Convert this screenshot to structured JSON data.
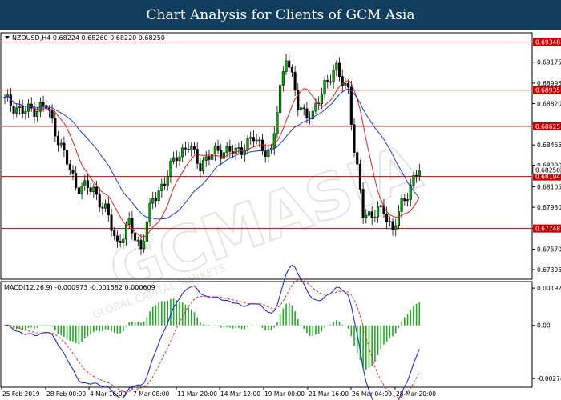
{
  "header": {
    "title": "Chart Analysis for Clients of GCM Asia"
  },
  "chart_data": {
    "type": "candlestick",
    "symbol_info": "NZDUSD,H4  0.68224 0.68260 0.68220 0.68250",
    "y_ticks": [
      "0.69175",
      "0.68995",
      "0.68820",
      "0.68645",
      "0.68465",
      "0.68290",
      "0.68105",
      "0.67930",
      "0.67750",
      "0.67570",
      "0.67395"
    ],
    "ylim": [
      0.6732,
      0.6942
    ],
    "x_ticks": [
      "25 Feb 2019",
      "28 Feb 00:00",
      "4 Mar 16:00",
      "7 Mar 08:00",
      "11 Mar 20:00",
      "14 Mar 12:00",
      "19 Mar 00:00",
      "21 Mar 16:00",
      "26 Mar 04:00",
      "28 Mar 20:00"
    ],
    "levels": [
      {
        "label": "0.69348",
        "value": 0.69348
      },
      {
        "label": "0.68935",
        "value": 0.68935
      },
      {
        "label": "0.68625",
        "value": 0.68625
      },
      {
        "label": "0.68194",
        "value": 0.68194
      },
      {
        "label": "0.67748",
        "value": 0.67748
      }
    ],
    "current_price": {
      "label": "0.68250",
      "value": 0.6825
    },
    "candle_colors": {
      "up": "#000000",
      "down": "#000000",
      "up_fill": "#00aa00",
      "down_fill": "#000000"
    },
    "ma_fast_color": "#dd2222",
    "ma_slow_color": "#1e3cd8",
    "level_color": "#cc0000",
    "macd": {
      "label": "MACD(12,26,9) -0.000973 -0.001582 0.000609",
      "y_ticks": [
        "0.001925",
        "0.00",
        "-0.002743"
      ],
      "ylim": [
        -0.00315,
        0.00222
      ],
      "line_color": "#1e2ce0",
      "signal_color": "#e03030",
      "hist_color": "#22aa22"
    }
  },
  "watermark": {
    "brand": "GCMASIA",
    "tagline": "GLOBAL CAPITAL MARKETS"
  }
}
